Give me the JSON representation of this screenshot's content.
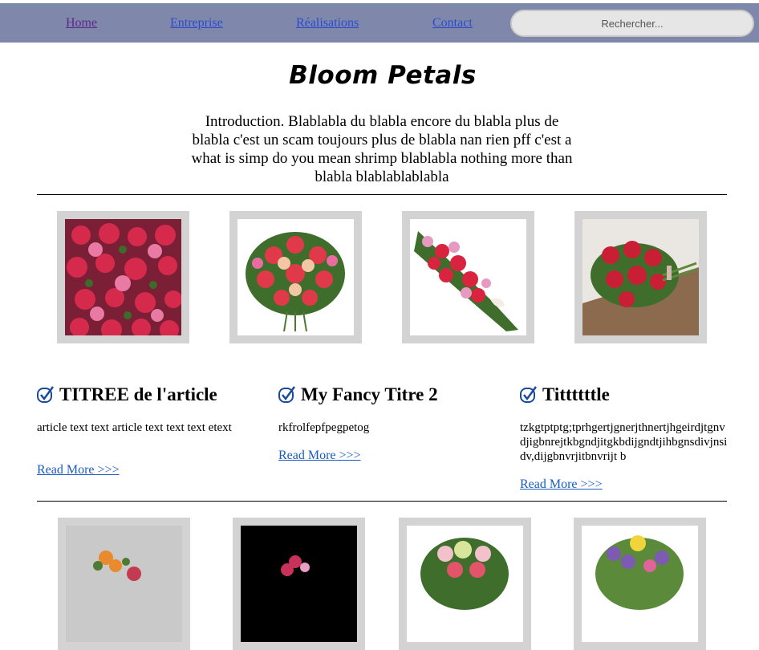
{
  "nav": {
    "links": [
      "Home",
      "Entreprise",
      "Réalisations",
      "Contact"
    ],
    "search_placeholder": "Rechercher..."
  },
  "header": {
    "title": "Bloom Petals",
    "intro": "Introduction. Blablabla du blabla encore du blabla plus de blabla c'est un scam toujours plus de blabla nan rien pff c'est a what is simp do you mean shrimp blablabla nothing more than blabla blablablablabla"
  },
  "gallery_top": [
    {
      "icon": "flower-bouquet-red-pink"
    },
    {
      "icon": "flower-bouquet-red-roses"
    },
    {
      "icon": "flower-spray-lilies"
    },
    {
      "icon": "flower-bouquet-on-table"
    }
  ],
  "articles": [
    {
      "title": "TITREE de l'article",
      "text": "article text text article text text text etext",
      "link": "Read More >>>"
    },
    {
      "title": "My Fancy Titre 2",
      "text": "rkfrolfepfpegpetog",
      "link": "Read More >>>"
    },
    {
      "title": "Tittttttle",
      "text": "tzkgtptptg;tprhgertjgnerjthnertjhgeirdjtgnvdjigbnrejtkbgndjitgkbdijgndtjihbgnsdivjnsidv,dijgbnvrjitbnvrijt b",
      "link": "Read More >>>"
    }
  ],
  "gallery_bottom": [
    {
      "icon": "flower-arrangement-orange"
    },
    {
      "icon": "flower-arrangement-dark"
    },
    {
      "icon": "flower-bouquet-pastel"
    },
    {
      "icon": "flower-bouquet-purple"
    }
  ],
  "colors": {
    "navbar": "#7f88aa",
    "frame": "#d3d3d3",
    "link": "#1a5bbf"
  }
}
